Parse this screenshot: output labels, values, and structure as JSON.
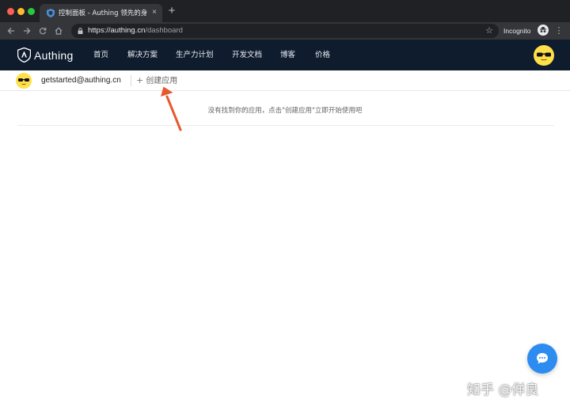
{
  "browser": {
    "tab_title": "控制面板 - Authing 领先的身份认",
    "tab_close": "×",
    "new_tab": "+",
    "url_host": "https://authing.cn",
    "url_path": "/dashboard",
    "incognito_label": "Incognito",
    "icons": [
      "back-icon",
      "forward-icon",
      "reload-icon",
      "home-icon",
      "lock-icon",
      "star-icon",
      "incognito-icon",
      "menu-icon"
    ]
  },
  "header": {
    "brand": "Authing",
    "nav": [
      "首页",
      "解决方案",
      "生产力计划",
      "开发文档",
      "博客",
      "价格"
    ]
  },
  "subbar": {
    "email": "getstarted@authing.cn",
    "create_plus": "+",
    "create_label": "创建应用"
  },
  "main": {
    "empty_message": "没有找到你的应用，点击\"创建应用\"立即开始使用吧"
  },
  "watermark": "知乎 @佯良",
  "colors": {
    "header_bg": "#0f1c2e",
    "fab": "#2d8cf0",
    "arrow": "#e8582f",
    "avatar": "#ffe04a"
  }
}
